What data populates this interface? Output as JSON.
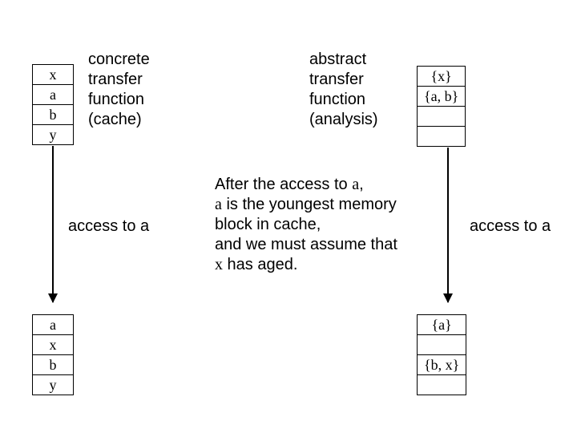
{
  "left": {
    "label": "concrete\ntransfer\nfunction\n(cache)",
    "top_box": [
      "x",
      "a",
      "b",
      "y"
    ],
    "action": "access to a",
    "bottom_box": [
      "a",
      "x",
      "b",
      "y"
    ]
  },
  "right": {
    "label": "abstract\ntransfer\nfunction\n(analysis)",
    "top_box": [
      "{x}",
      "{a, b}",
      "",
      ""
    ],
    "action": "access to a",
    "bottom_box": [
      "{a}",
      "",
      "{b, x}",
      ""
    ]
  },
  "explain": {
    "l1": "After the access to ",
    "l1a": "a",
    "l1b": ",",
    "l2a": "a",
    "l2": " is the youngest memory",
    "l3": "block in cache,",
    "l4": "and we must assume that",
    "l5a": "x",
    "l5": " has aged."
  }
}
